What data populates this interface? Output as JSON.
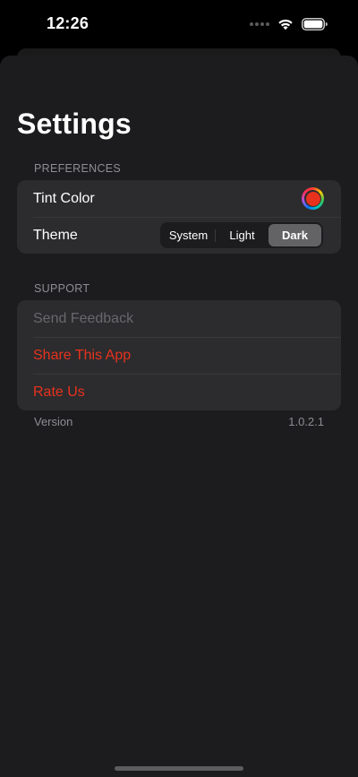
{
  "status_bar": {
    "time": "12:26",
    "icons": [
      "cellular-dots-icon",
      "wifi-icon",
      "battery-icon"
    ]
  },
  "header": {
    "title": "Settings"
  },
  "preferences": {
    "header": "PREFERENCES",
    "tint_color_label": "Tint Color",
    "tint_color_value": "#e8321e",
    "theme_label": "Theme",
    "theme_options": [
      "System",
      "Light",
      "Dark"
    ],
    "theme_selected": "Dark"
  },
  "support": {
    "header": "SUPPORT",
    "items": [
      {
        "label": "Send Feedback",
        "state": "disabled"
      },
      {
        "label": "Share This App",
        "state": "accent"
      },
      {
        "label": "Rate Us",
        "state": "accent"
      }
    ]
  },
  "footer": {
    "version_label": "Version",
    "version_value": "1.0.2.1"
  },
  "colors": {
    "accent": "#e8321e",
    "background": "#1c1c1e",
    "group_background": "#2c2c2e"
  }
}
